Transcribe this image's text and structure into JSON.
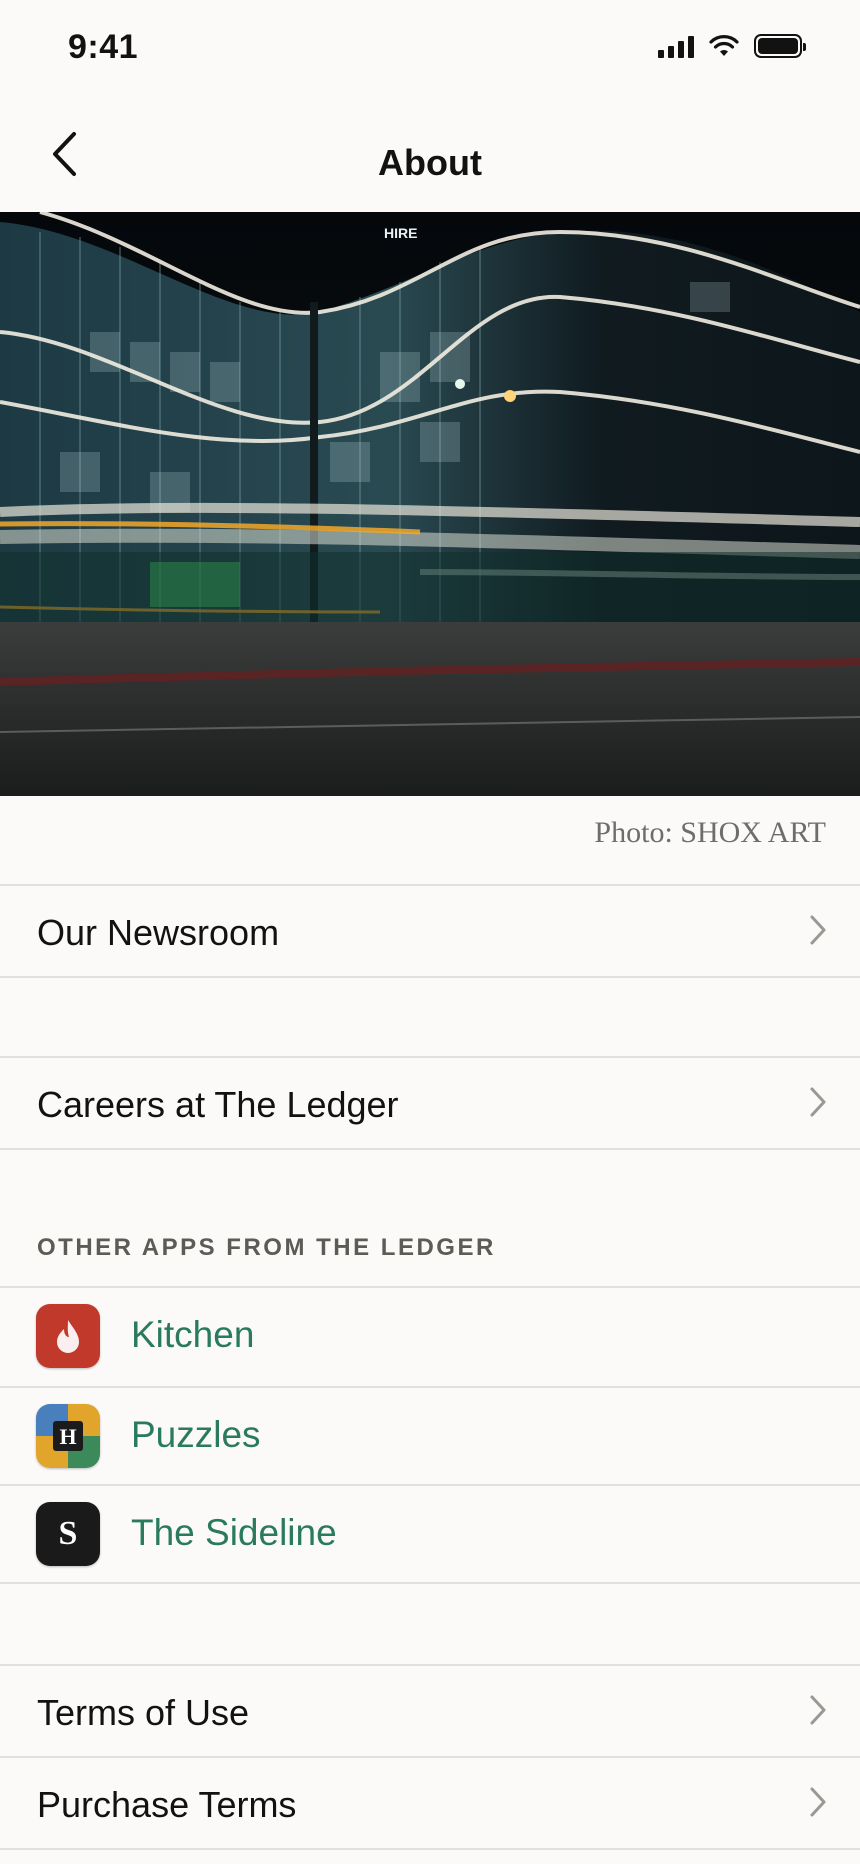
{
  "status_bar": {
    "time": "9:41"
  },
  "nav": {
    "title": "About",
    "back_icon": "chevron-left-icon"
  },
  "hero": {
    "photo_credit": "Photo: SHOX ART",
    "sign_text": "HIRE"
  },
  "links_primary": [
    {
      "label": "Our Newsroom"
    },
    {
      "label": "Careers at The Ledger"
    }
  ],
  "other_apps": {
    "header": "OTHER APPS FROM THE LEDGER",
    "items": [
      {
        "label": "Kitchen",
        "icon": "flame-icon",
        "color": "#c0392b"
      },
      {
        "label": "Puzzles",
        "icon": "puzzles-h-icon",
        "glyph": "H"
      },
      {
        "label": "The Sideline",
        "icon": "sideline-s-icon",
        "glyph": "S",
        "color": "#1a1a1a"
      }
    ]
  },
  "links_legal": [
    {
      "label": "Terms of Use"
    },
    {
      "label": "Purchase Terms"
    }
  ],
  "colors": {
    "background": "#fbfaf8",
    "accent_green": "#2a7a5d",
    "divider": "#e2e0dc"
  }
}
